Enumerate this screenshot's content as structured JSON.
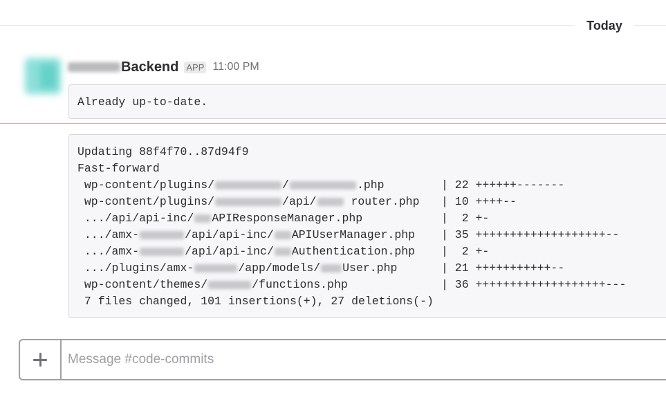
{
  "divider": {
    "day_label": "Today"
  },
  "message": {
    "sender_name": "Backend",
    "badge": "APP",
    "time": "11:00 PM",
    "first_output": "Already up-to-date.",
    "second_output": {
      "header_lines": [
        "Updating 88f4f70..87d94f9",
        "Fast-forward"
      ],
      "files": [
        {
          "parts": [
            " wp-content/plugins/",
            "",
            "/",
            "",
            ".php"
          ],
          "stat": "| 22 ++++++-------"
        },
        {
          "parts": [
            " wp-content/plugins/",
            "",
            "/api/",
            "",
            " router.php"
          ],
          "stat": "| 10 ++++--"
        },
        {
          "parts": [
            " .../api/api-inc/",
            "",
            "APIResponseManager.php"
          ],
          "stat": "|  2 +-"
        },
        {
          "parts": [
            " .../amx-",
            "",
            "/api/api-inc/",
            "",
            "APIUserManager.php"
          ],
          "stat": "| 35 +++++++++++++++++++--"
        },
        {
          "parts": [
            " .../amx-",
            "",
            "/api/api-inc/",
            "",
            "Authentication.php"
          ],
          "stat": "|  2 +-"
        },
        {
          "parts": [
            " .../plugins/amx-",
            "",
            "/app/models/",
            "",
            "User.php"
          ],
          "stat": "| 21 +++++++++++--"
        },
        {
          "parts": [
            " wp-content/themes/",
            "",
            "/functions.php"
          ],
          "stat": "| 36 +++++++++++++++++++---"
        }
      ],
      "summary": " 7 files changed, 101 insertions(+), 27 deletions(-)"
    }
  },
  "composer": {
    "placeholder": "Message #code-commits",
    "value": ""
  },
  "icons": {
    "attach": "plus-icon"
  }
}
